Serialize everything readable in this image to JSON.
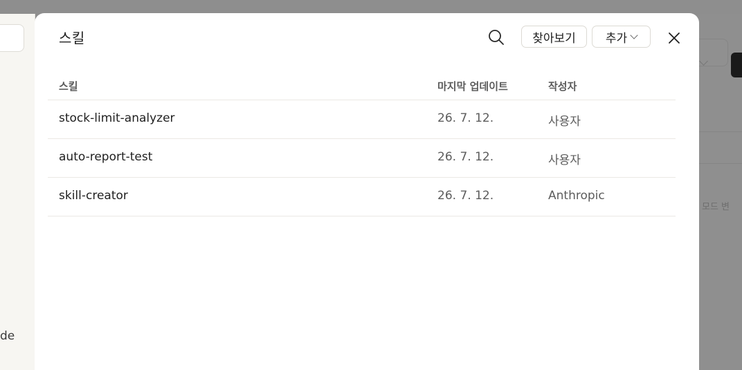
{
  "background": {
    "sidebar_partial_text": "de",
    "right_partial_text": "모드 변"
  },
  "modal": {
    "title": "스킬",
    "browse_label": "찾아보기",
    "add_label": "추가",
    "icons": {
      "search": "search-icon",
      "close": "close-icon",
      "add_dropdown": "chevron-down-icon"
    }
  },
  "table": {
    "headers": {
      "name": "스킬",
      "last_updated": "마지막 업데이트",
      "author": "작성자"
    },
    "rows": [
      {
        "name": "stock-limit-analyzer",
        "updated": "26. 7. 12.",
        "author": "사용자"
      },
      {
        "name": "auto-report-test",
        "updated": "26. 7. 12.",
        "author": "사용자"
      },
      {
        "name": "skill-creator",
        "updated": "26. 7. 12.",
        "author": "Anthropic"
      }
    ]
  }
}
